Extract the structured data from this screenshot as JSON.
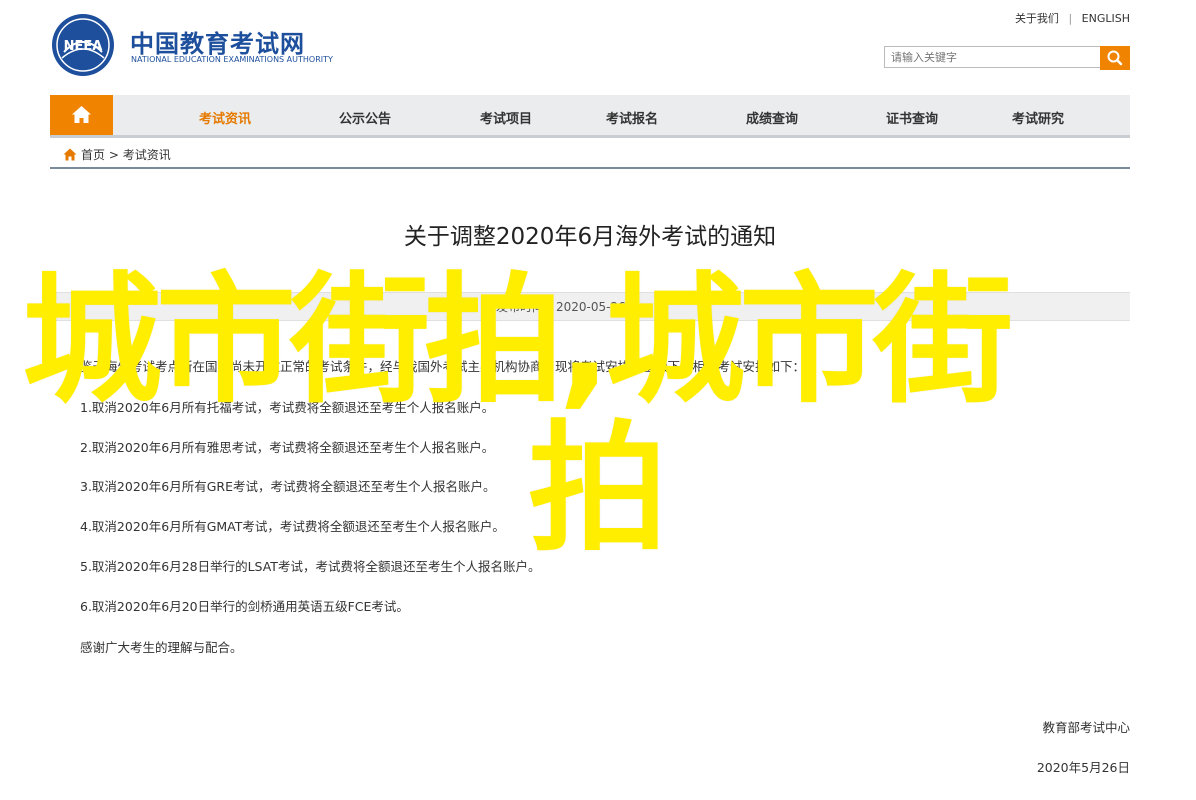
{
  "header": {
    "site_name": "中国教育考试网",
    "site_name_en": "NATIONAL EDUCATION EXAMINATIONS AUTHORITY",
    "logo_text": "NEEA",
    "links": [
      "关于我们",
      "ENGLISH"
    ],
    "search_placeholder": "请输入关键字"
  },
  "nav": {
    "items": [
      "考试资讯",
      "公示公告",
      "考试项目",
      "考试报名",
      "成绩查询",
      "证书查询",
      "考试研究"
    ],
    "active_index": 0
  },
  "breadcrumb": [
    "首页",
    ">",
    "考试资讯"
  ],
  "article": {
    "title": "关于调整2020年6月海外考试的通知",
    "date": "发布时间：2020-05-26",
    "intro": "鉴于海外考试考点所在国家尚未开放正常的考试条件，经与我国外考试主办机构协商，现将考试安排调整如下，相关考试安排如下：",
    "items": [
      "1.取消2020年6月所有托福考试，考试费将全额退还至考生个人报名账户。",
      "2.取消2020年6月所有雅思考试，考试费将全额退还至考生个人报名账户。",
      "3.取消2020年6月所有GRE考试，考试费将全额退还至考生个人报名账户。",
      "4.取消2020年6月所有GMAT考试，考试费将全额退还至考生个人报名账户。",
      "5.取消2020年6月28日举行的LSAT考试，考试费将全额退还至考生个人报名账户。",
      "6.取消2020年6月20日举行的剑桥通用英语五级FCE考试。"
    ],
    "thanks": "感谢广大考生的理解与配合。",
    "signature": "教育部考试中心",
    "sign_date": "2020年5月26日"
  },
  "overlay": {
    "line1": "城市街拍,城市街",
    "line2": "拍",
    "color": "#ffee00"
  },
  "colors": {
    "brand": "#1d4f9c",
    "accent": "#f08300",
    "nav_bg": "#eaecee"
  }
}
